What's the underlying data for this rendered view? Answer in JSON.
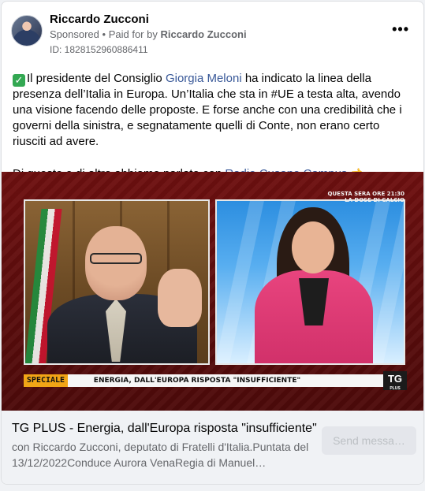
{
  "post": {
    "author": "Riccardo Zucconi",
    "sponsored_label": "Sponsored",
    "separator": "•",
    "paid_for_by_label": "Paid for by",
    "payer": "Riccardo Zucconi",
    "ad_id": "ID: 1828152960886411",
    "more_icon": "more-horizontal-icon",
    "more_glyph": "•••"
  },
  "body": {
    "check_icon": "check-mark-button-icon",
    "check_glyph": "✓",
    "p1_before_link": "Il presidente del Consiglio ",
    "p1_link": "Giorgia Meloni",
    "p1_after_link": " ha indicato la linea della presenza dell’Italia in Europa. Un’Italia che sta in #UE a testa alta, avendo una visione facendo delle proposte. E forse anche con una credibilità che i governi della sinistra, e segnatamente quelli di Conte, non erano certo riusciti ad avere.",
    "p2_before_link": "Di questo e di altro abbiamo parlato con ",
    "p2_link": "Radio Cusano Campus",
    "p2_emoji_icon": "backhand-index-pointing-left-icon",
    "p2_emoji_glyph": "👈"
  },
  "video": {
    "top_caption_line1": "QUESTA SERA ORE 21:30",
    "top_caption_line2": "LA DOSE DI CALCIO",
    "banner_tag": "SPECIALE",
    "banner_text": "ENERGIA, DALL'EUROPA RISPOSTA \"INSUFFICIENTE\"",
    "logo_main": "TG",
    "logo_sub": "PLUS"
  },
  "link_preview": {
    "title": "TG PLUS - Energia, dall'Europa risposta \"insufficiente\"",
    "description": "con Riccardo Zucconi, deputato di Fratelli d'Italia.Puntata del 13/12/2022Conduce Aurora VenaRegia di Manuel…",
    "button_label": "Send messa…"
  },
  "colors": {
    "link": "#385898",
    "secondary_text": "#65676b",
    "banner_accent": "#f2a516",
    "video_bg": "#6e1010",
    "check_green": "#33a852"
  }
}
